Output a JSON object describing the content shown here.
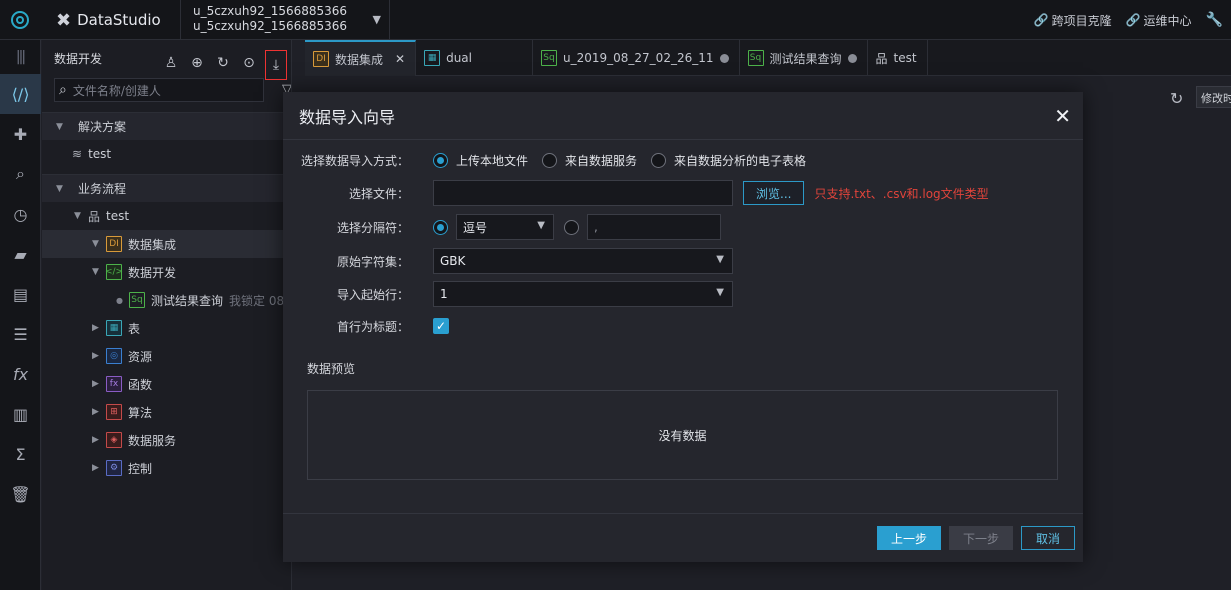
{
  "topbar": {
    "brand": "DataStudio",
    "project_line1": "u_5czxuh92_1566885366",
    "project_line2": "u_5czxuh92_1566885366",
    "links": [
      "跨项目克隆",
      "运维中心"
    ]
  },
  "side": {
    "title": "数据开发",
    "search_placeholder": "文件名称/创建人",
    "section_solution": "解决方案",
    "solution_item": "test",
    "section_flow": "业务流程",
    "flow_root": "test",
    "items": [
      {
        "label": "数据集成",
        "icon": "DI",
        "color": "#d89a3a"
      },
      {
        "label": "数据开发",
        "icon": "</>",
        "color": "#4db24a"
      },
      {
        "label": "测试结果查询",
        "icon": "Sq",
        "color": "#4db24a",
        "meta": "我锁定 08"
      },
      {
        "label": "表",
        "icon": "▦",
        "color": "#3aa7b7"
      },
      {
        "label": "资源",
        "icon": "◎",
        "color": "#3a7fd0"
      },
      {
        "label": "函数",
        "icon": "fx",
        "color": "#8a5cc4"
      },
      {
        "label": "算法",
        "icon": "⊞",
        "color": "#c44a4a"
      },
      {
        "label": "数据服务",
        "icon": "◈",
        "color": "#c44a4a"
      },
      {
        "label": "控制",
        "icon": "⚙",
        "color": "#5a6cc4"
      }
    ]
  },
  "tabs": [
    {
      "label": "数据集成",
      "icon": "DI",
      "color": "#d89a3a",
      "active": true
    },
    {
      "label": "dual",
      "icon": "▦",
      "color": "#3aa7b7"
    },
    {
      "label": "u_2019_08_27_02_26_11",
      "icon": "Sq",
      "color": "#4db24a"
    },
    {
      "label": "测试结果查询",
      "icon": "Sq",
      "color": "#4db24a"
    },
    {
      "label": "test",
      "icon": "品",
      "color": "#c2c5cd"
    }
  ],
  "main": {
    "modify_label": "修改时"
  },
  "modal": {
    "title": "数据导入向导",
    "import_method_label": "选择数据导入方式：",
    "import_options": [
      "上传本地文件",
      "来自数据服务",
      "来自数据分析的电子表格"
    ],
    "file_label": "选择文件：",
    "file_value": "",
    "browse_label": "浏览...",
    "file_hint": "只支持.txt、.csv和.log文件类型",
    "delimiter_label": "选择分隔符：",
    "delimiter_value": "逗号",
    "delimiter_custom": ",",
    "charset_label": "原始字符集：",
    "charset_value": "GBK",
    "start_row_label": "导入起始行：",
    "start_row_value": "1",
    "header_label": "首行为标题：",
    "preview_title": "数据预览",
    "preview_empty": "没有数据",
    "btn_prev": "上一步",
    "btn_next": "下一步",
    "btn_cancel": "取消"
  }
}
